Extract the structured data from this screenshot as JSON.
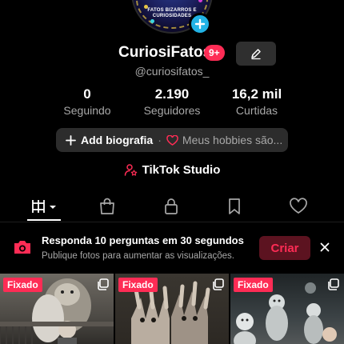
{
  "colors": {
    "accent": "#fe2c55",
    "background": "#000000",
    "secondary_text": "#a8a8a8",
    "pill": "#2c2c2c",
    "avatar_plus": "#22b3e6"
  },
  "profile": {
    "avatar_text": "FATOS BIZARROS E CURIOSIDADES",
    "username": "CuriosiFatos",
    "notification_badge": "9+",
    "handle": "@curiosifatos_"
  },
  "stats": [
    {
      "value": "0",
      "label": "Seguindo"
    },
    {
      "value": "2.190",
      "label": "Seguidores"
    },
    {
      "value": "16,2 mil",
      "label": "Curtidas"
    }
  ],
  "bio": {
    "add_label": "Add biografia",
    "separator": "·",
    "hobbies_label": "Meus hobbies são..."
  },
  "studio": {
    "label": "TikTok Studio",
    "icon": "person-star-icon"
  },
  "tabs": [
    {
      "name": "videos",
      "icon": "grid-icon",
      "active": true
    },
    {
      "name": "shop",
      "icon": "bag-icon"
    },
    {
      "name": "private",
      "icon": "lock-icon"
    },
    {
      "name": "saved",
      "icon": "bookmark-icon"
    },
    {
      "name": "liked",
      "icon": "heart-icon"
    }
  ],
  "banner": {
    "title": "Responda 10 perguntas em 30 segundos",
    "subtitle": "Publique fotos para aumentar as visualizações.",
    "button_label": "Criar"
  },
  "grid": [
    {
      "badge": "Fixado",
      "multi": true
    },
    {
      "badge": "Fixado",
      "multi": true
    },
    {
      "badge": "Fixado",
      "multi": true
    }
  ]
}
